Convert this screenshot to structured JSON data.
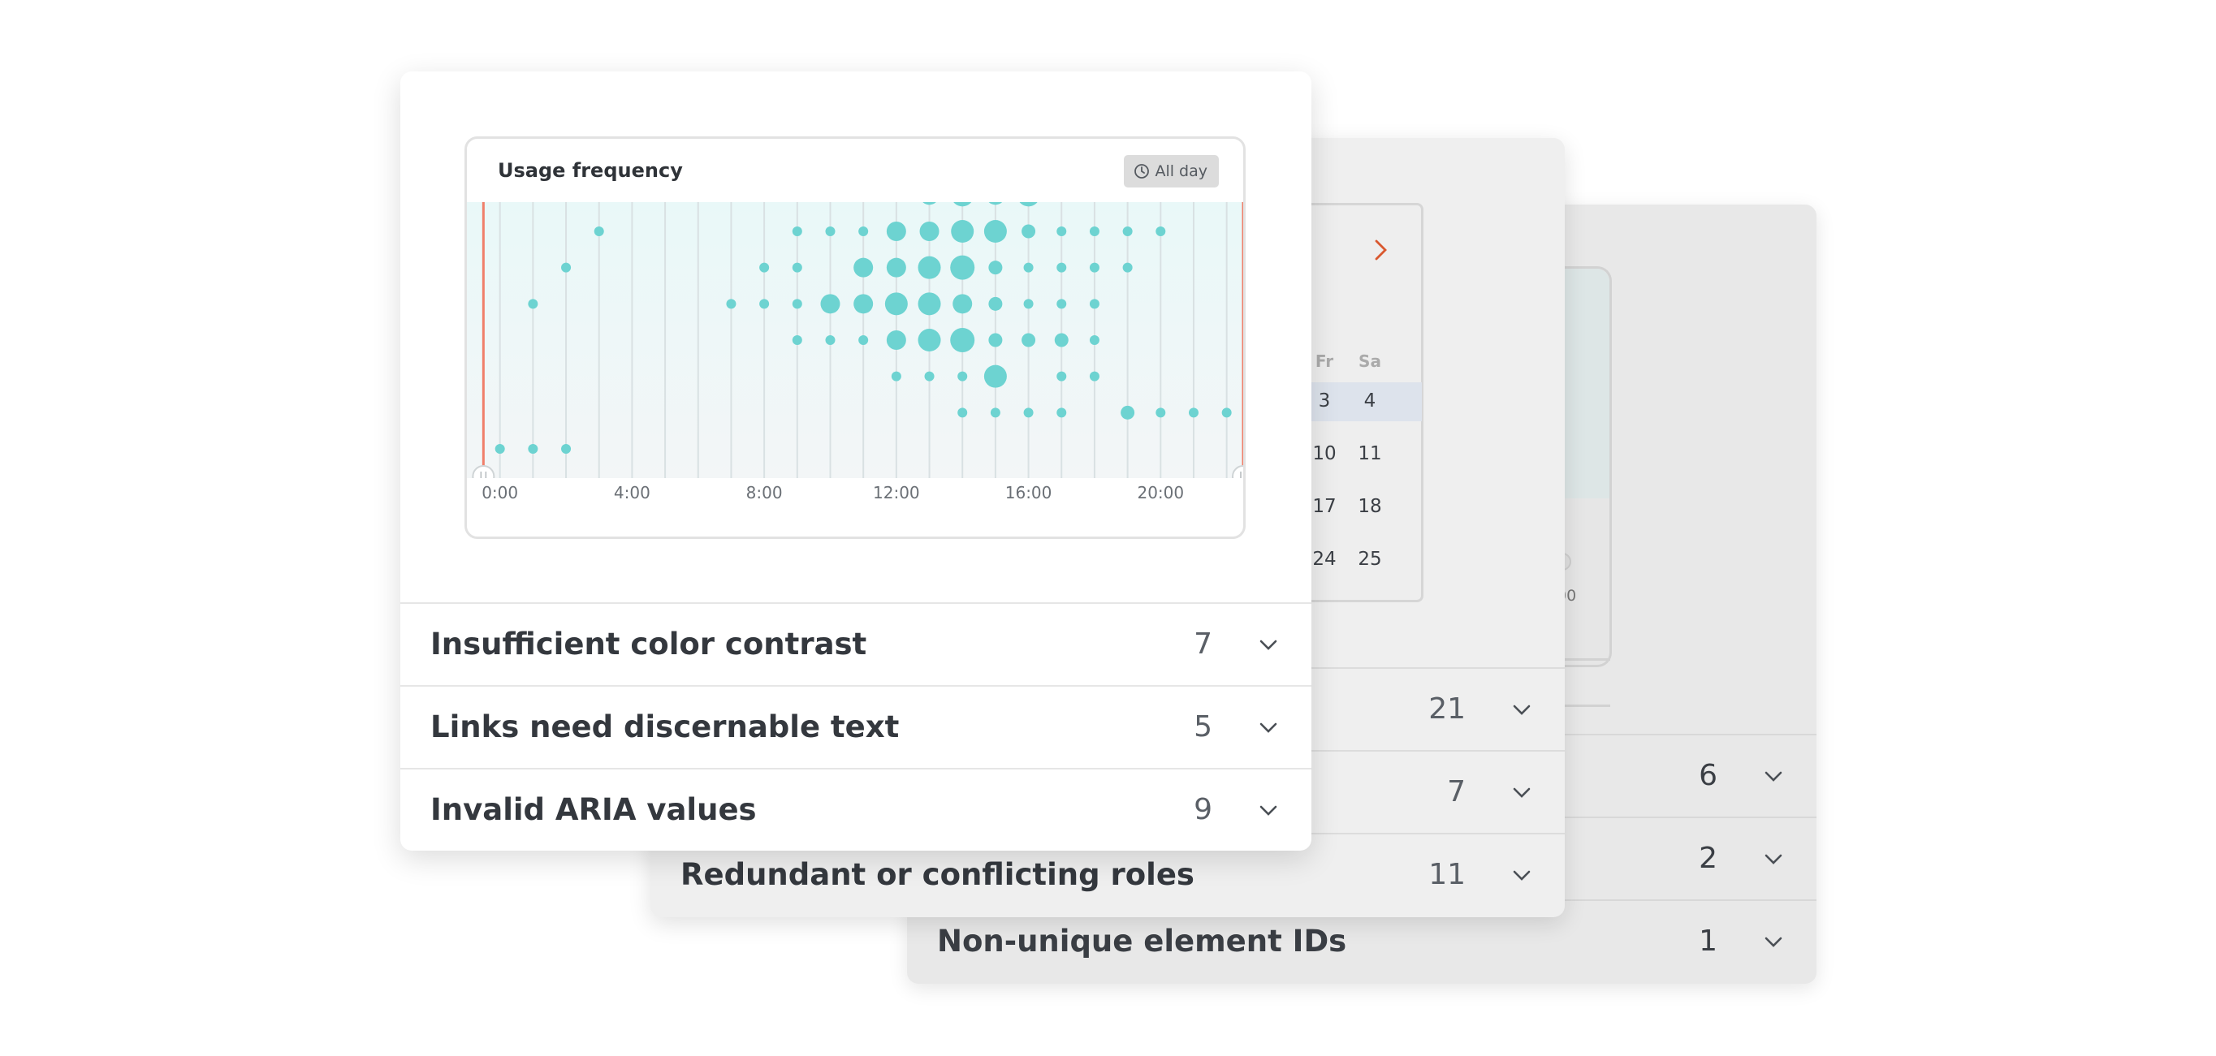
{
  "colors": {
    "accent": "#6dd3d1",
    "handle_line": "#f07f6a",
    "chevron": "#d9582f"
  },
  "back_card": {
    "axis_tick_partial": "00",
    "rows": [
      {
        "label": "",
        "count": "6"
      },
      {
        "label": "",
        "count": "2"
      },
      {
        "label": "Non-unique element IDs",
        "count": "1"
      }
    ]
  },
  "middle_card": {
    "calendar": {
      "next_icon": "chevron-right-icon",
      "headers": [
        "Fr",
        "Sa"
      ],
      "weeks": [
        [
          "3",
          "4"
        ],
        [
          "10",
          "11"
        ],
        [
          "17",
          "18"
        ],
        [
          "24",
          "25"
        ]
      ]
    },
    "rows": [
      {
        "label": "",
        "count": "21"
      },
      {
        "label": "",
        "count": "7"
      },
      {
        "label": "Redundant or conflicting roles",
        "count": "11"
      }
    ]
  },
  "front_card": {
    "chart_panel": {
      "title": "Usage frequency",
      "filter_label": "All day",
      "filter_icon": "clock-icon"
    },
    "rows": [
      {
        "label": "Insufficient color contrast",
        "count": "7"
      },
      {
        "label": "Links need discernable text",
        "count": "5"
      },
      {
        "label": "Invalid ARIA values",
        "count": "9"
      }
    ]
  },
  "chart_data": {
    "type": "scatter",
    "title": "Usage frequency",
    "x_ticks": [
      "0:00",
      "4:00",
      "8:00",
      "12:00",
      "16:00",
      "20:00"
    ],
    "x_range": [
      -0.5,
      23
    ],
    "y_range": [
      0.5,
      7.5
    ],
    "selection_range": [
      "0:00",
      "23:00"
    ],
    "points": [
      {
        "x": 0.5,
        "y": 7,
        "s": 1
      },
      {
        "x": 1.5,
        "y": 7,
        "s": 1
      },
      {
        "x": 2.5,
        "y": 7,
        "s": 1
      },
      {
        "x": 1.5,
        "y": 3,
        "s": 1
      },
      {
        "x": 2.5,
        "y": 2,
        "s": 1
      },
      {
        "x": 3.5,
        "y": 1,
        "s": 1
      },
      {
        "x": 7.5,
        "y": 3,
        "s": 1
      },
      {
        "x": 8.5,
        "y": 2,
        "s": 1
      },
      {
        "x": 8.5,
        "y": 3,
        "s": 1
      },
      {
        "x": 9.5,
        "y": 1,
        "s": 1
      },
      {
        "x": 9.5,
        "y": 2,
        "s": 1
      },
      {
        "x": 9.5,
        "y": 3,
        "s": 1
      },
      {
        "x": 9.5,
        "y": 4,
        "s": 1
      },
      {
        "x": 10.5,
        "y": 0,
        "s": 1
      },
      {
        "x": 10.5,
        "y": 1,
        "s": 1
      },
      {
        "x": 10.5,
        "y": 3,
        "s": 3
      },
      {
        "x": 10.5,
        "y": 4,
        "s": 1
      },
      {
        "x": 11.5,
        "y": 0,
        "s": 1
      },
      {
        "x": 11.5,
        "y": 1,
        "s": 1
      },
      {
        "x": 11.5,
        "y": 2,
        "s": 3
      },
      {
        "x": 11.5,
        "y": 3,
        "s": 3
      },
      {
        "x": 11.5,
        "y": 4,
        "s": 1
      },
      {
        "x": 12.5,
        "y": 0,
        "s": 1
      },
      {
        "x": 12.5,
        "y": 1,
        "s": 3
      },
      {
        "x": 12.5,
        "y": 2,
        "s": 3
      },
      {
        "x": 12.5,
        "y": 3,
        "s": 4
      },
      {
        "x": 12.5,
        "y": 4,
        "s": 3
      },
      {
        "x": 12.5,
        "y": 5,
        "s": 1
      },
      {
        "x": 13.5,
        "y": 0,
        "s": 3
      },
      {
        "x": 13.5,
        "y": 1,
        "s": 3
      },
      {
        "x": 13.5,
        "y": 2,
        "s": 4
      },
      {
        "x": 13.5,
        "y": 3,
        "s": 4
      },
      {
        "x": 13.5,
        "y": 4,
        "s": 4
      },
      {
        "x": 13.5,
        "y": 5,
        "s": 1
      },
      {
        "x": 14.5,
        "y": 0,
        "s": 4
      },
      {
        "x": 14.5,
        "y": 1,
        "s": 4
      },
      {
        "x": 14.5,
        "y": 2,
        "s": 5
      },
      {
        "x": 14.5,
        "y": 3,
        "s": 3
      },
      {
        "x": 14.5,
        "y": 4,
        "s": 5
      },
      {
        "x": 14.5,
        "y": 5,
        "s": 1
      },
      {
        "x": 14.5,
        "y": 6,
        "s": 1
      },
      {
        "x": 15.5,
        "y": 0,
        "s": 3
      },
      {
        "x": 15.5,
        "y": 1,
        "s": 4
      },
      {
        "x": 15.5,
        "y": 2,
        "s": 2
      },
      {
        "x": 15.5,
        "y": 3,
        "s": 2
      },
      {
        "x": 15.5,
        "y": 4,
        "s": 2
      },
      {
        "x": 15.5,
        "y": 5,
        "s": 4
      },
      {
        "x": 15.5,
        "y": 6,
        "s": 1
      },
      {
        "x": 16.5,
        "y": 0,
        "s": 4
      },
      {
        "x": 16.5,
        "y": 1,
        "s": 2
      },
      {
        "x": 16.5,
        "y": 2,
        "s": 1
      },
      {
        "x": 16.5,
        "y": 3,
        "s": 1
      },
      {
        "x": 16.5,
        "y": 4,
        "s": 2
      },
      {
        "x": 16.5,
        "y": 6,
        "s": 1
      },
      {
        "x": 17.5,
        "y": 0,
        "s": 2
      },
      {
        "x": 17.5,
        "y": 1,
        "s": 1
      },
      {
        "x": 17.5,
        "y": 2,
        "s": 1
      },
      {
        "x": 17.5,
        "y": 3,
        "s": 1
      },
      {
        "x": 17.5,
        "y": 4,
        "s": 2
      },
      {
        "x": 17.5,
        "y": 5,
        "s": 1
      },
      {
        "x": 17.5,
        "y": 6,
        "s": 1
      },
      {
        "x": 18.5,
        "y": 0,
        "s": 1
      },
      {
        "x": 18.5,
        "y": 1,
        "s": 1
      },
      {
        "x": 18.5,
        "y": 2,
        "s": 1
      },
      {
        "x": 18.5,
        "y": 3,
        "s": 1
      },
      {
        "x": 18.5,
        "y": 4,
        "s": 1
      },
      {
        "x": 18.5,
        "y": 5,
        "s": 1
      },
      {
        "x": 19.5,
        "y": 0,
        "s": 1
      },
      {
        "x": 19.5,
        "y": 1,
        "s": 1
      },
      {
        "x": 19.5,
        "y": 2,
        "s": 1
      },
      {
        "x": 19.5,
        "y": 6,
        "s": 2
      },
      {
        "x": 20.5,
        "y": 0,
        "s": 1
      },
      {
        "x": 20.5,
        "y": 1,
        "s": 1
      },
      {
        "x": 20.5,
        "y": 6,
        "s": 1
      },
      {
        "x": 21.5,
        "y": 0,
        "s": 1
      },
      {
        "x": 21.5,
        "y": 6,
        "s": 1
      },
      {
        "x": 22.5,
        "y": 6,
        "s": 1
      }
    ]
  }
}
